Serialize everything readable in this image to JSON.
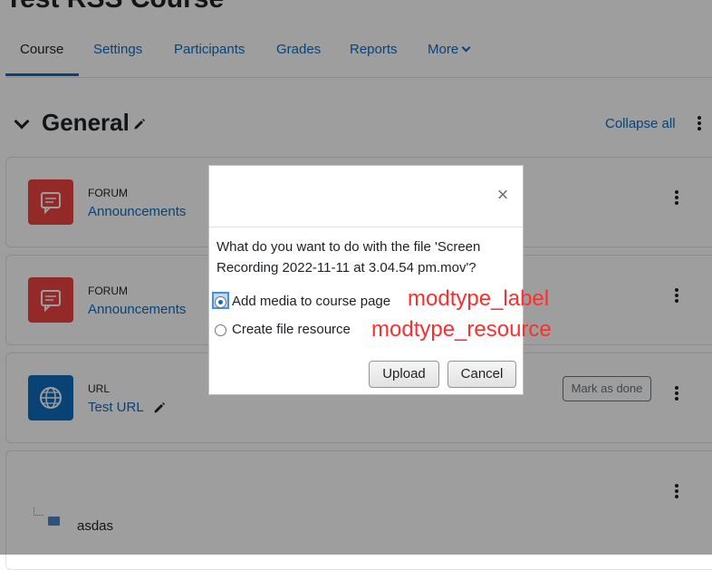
{
  "course": {
    "title": "Test RSS Course"
  },
  "nav": {
    "items": [
      "Course",
      "Settings",
      "Participants",
      "Grades",
      "Reports",
      "More"
    ]
  },
  "section": {
    "title": "General",
    "collapse_all": "Collapse all"
  },
  "activities": [
    {
      "type": "FORUM",
      "name": "Announcements",
      "icon": "forum-icon"
    },
    {
      "type": "FORUM",
      "name": "Announcements",
      "icon": "forum-icon"
    },
    {
      "type": "URL",
      "name": "Test URL",
      "icon": "globe-icon",
      "button": "Mark as done"
    },
    {
      "type": "",
      "name": "asdas",
      "icon": "folder-icon"
    }
  ],
  "dialog": {
    "question": "What do you want to do with the file 'Screen Recording 2022-11-11 at 3.04.54 pm.mov'?",
    "options": [
      {
        "label": "Add media to course page",
        "selected": true
      },
      {
        "label": "Create file resource",
        "selected": false
      }
    ],
    "upload": "Upload",
    "cancel": "Cancel",
    "close": "×"
  },
  "annotations": {
    "label": "modtype_label",
    "resource": "modtype_resource",
    "color": "#ff2e2e"
  },
  "colors": {
    "link": "#0f6cbf",
    "forum": "#ef4542",
    "url": "#0f6cbf"
  }
}
